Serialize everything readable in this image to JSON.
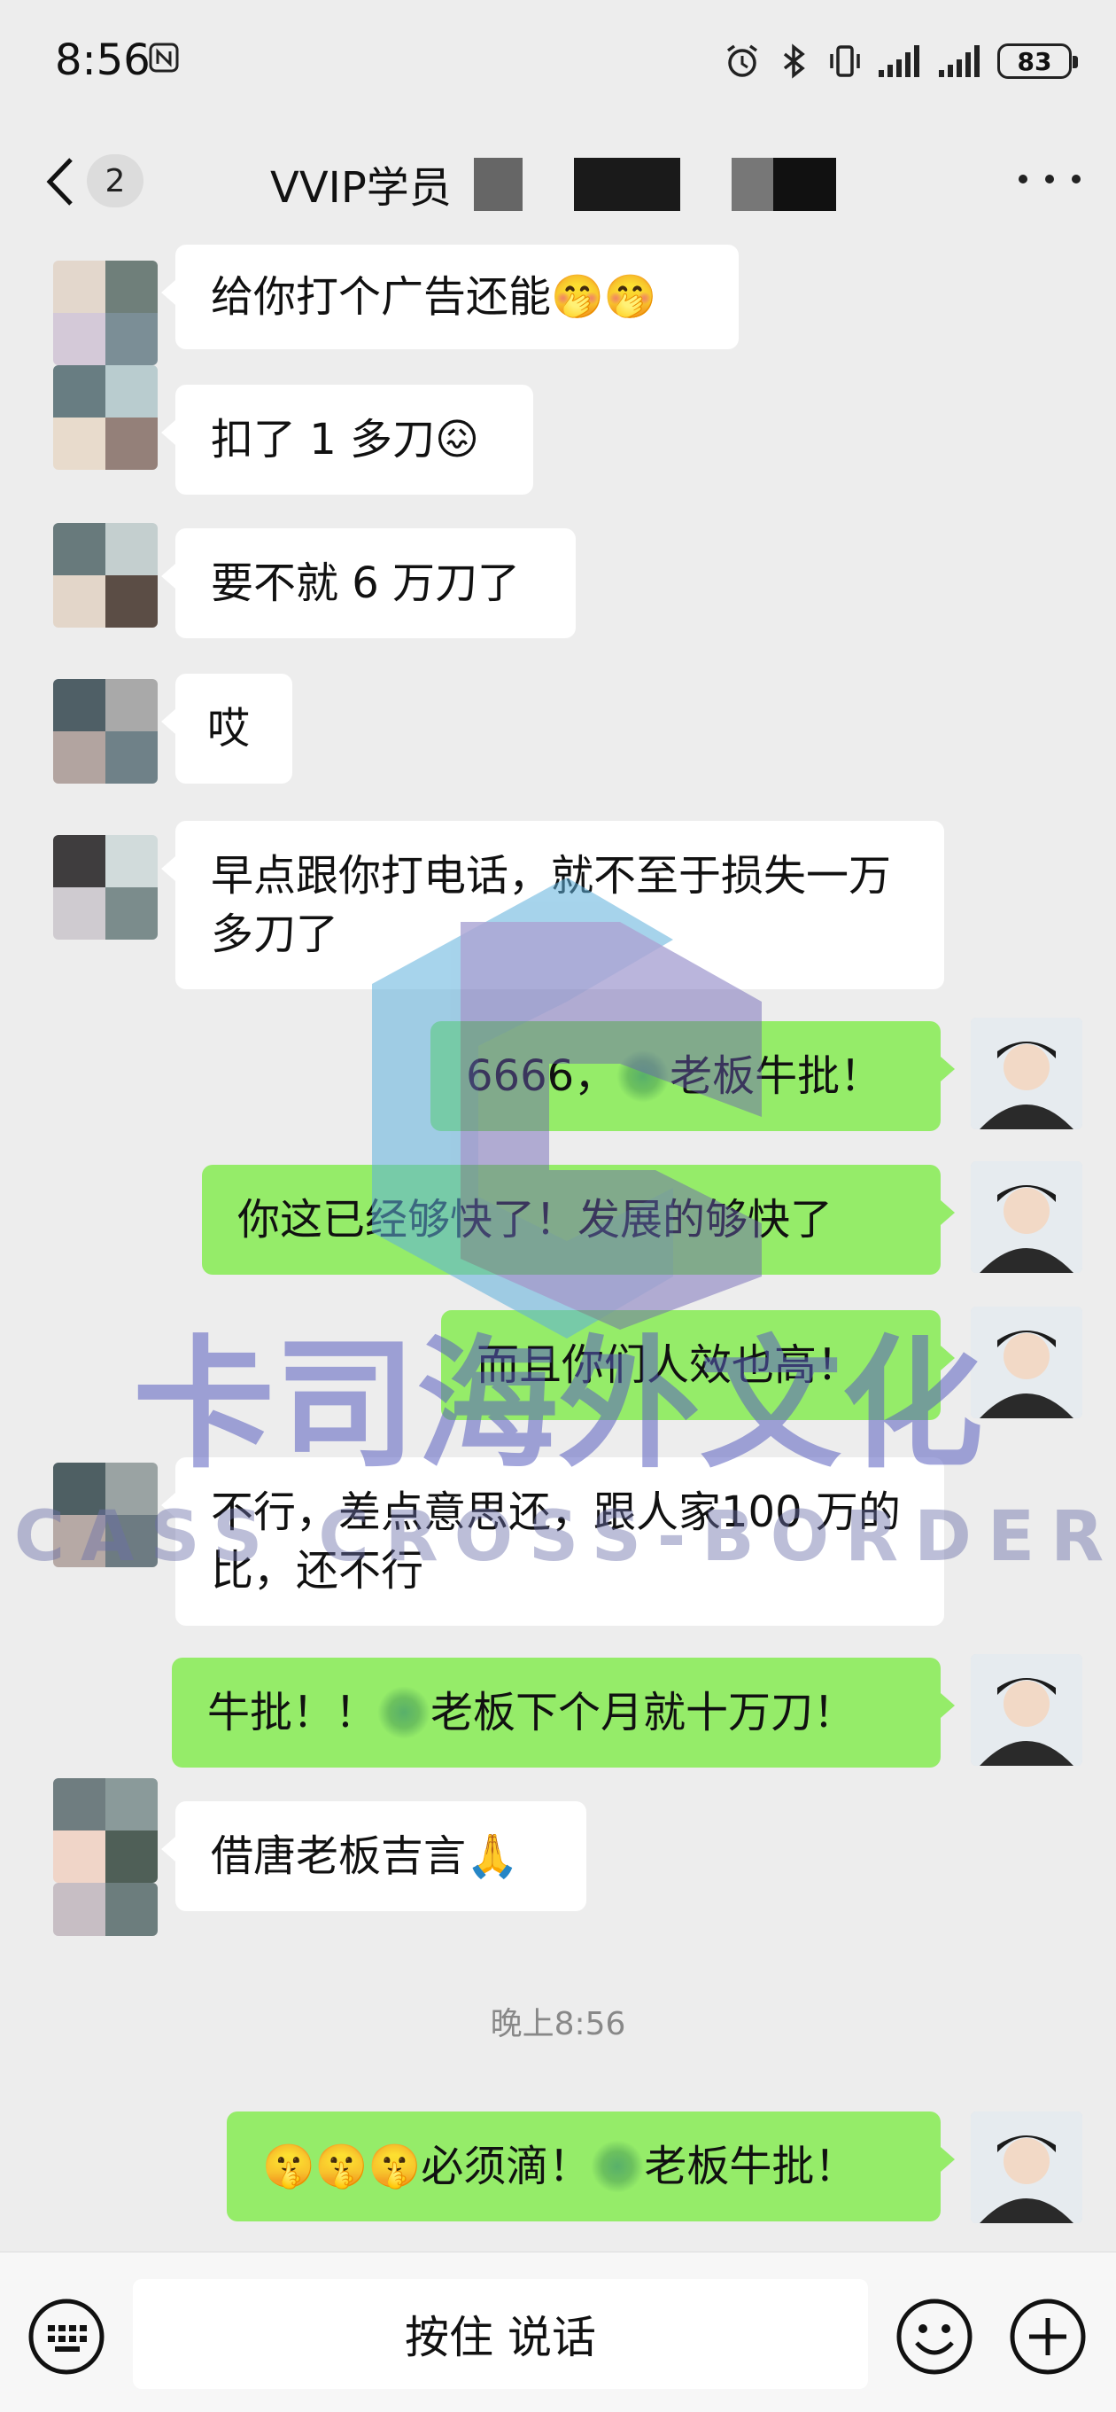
{
  "status": {
    "time": "8:56",
    "battery": "83"
  },
  "header": {
    "back_count": "2",
    "title": "VVIP学员"
  },
  "messages": {
    "m1": "给你打个广告还能🤭🤭",
    "m2": "扣了 1 多刀😖",
    "m3": "要不就 6 万刀了",
    "m4": "哎",
    "m5": "早点跟你打电话，就不至于损失一万多刀了",
    "m6a": "6666，",
    "m6b": "老板牛批！",
    "m7": "你这已经够快了！发展的够快了",
    "m8": "而且你们人效也高！",
    "m9": "不行，差点意思还，跟人家100 万的比，还不行",
    "m10a": "牛批！！",
    "m10b": "老板下个月就十万刀！",
    "m11": "借唐老板吉言🙏",
    "m12a": "🤫🤫🤫必须滴！",
    "m12b": "老板牛批！"
  },
  "timestamp": "晚上8:56",
  "watermark": {
    "cn": "卡司海外文化",
    "en": "CASS CROSS-BORDER"
  },
  "input_bar": {
    "voice_label": "按住 说话"
  },
  "colors": {
    "outgoing": "#95EC69",
    "incoming": "#FFFFFF",
    "background": "#EDEDED"
  }
}
